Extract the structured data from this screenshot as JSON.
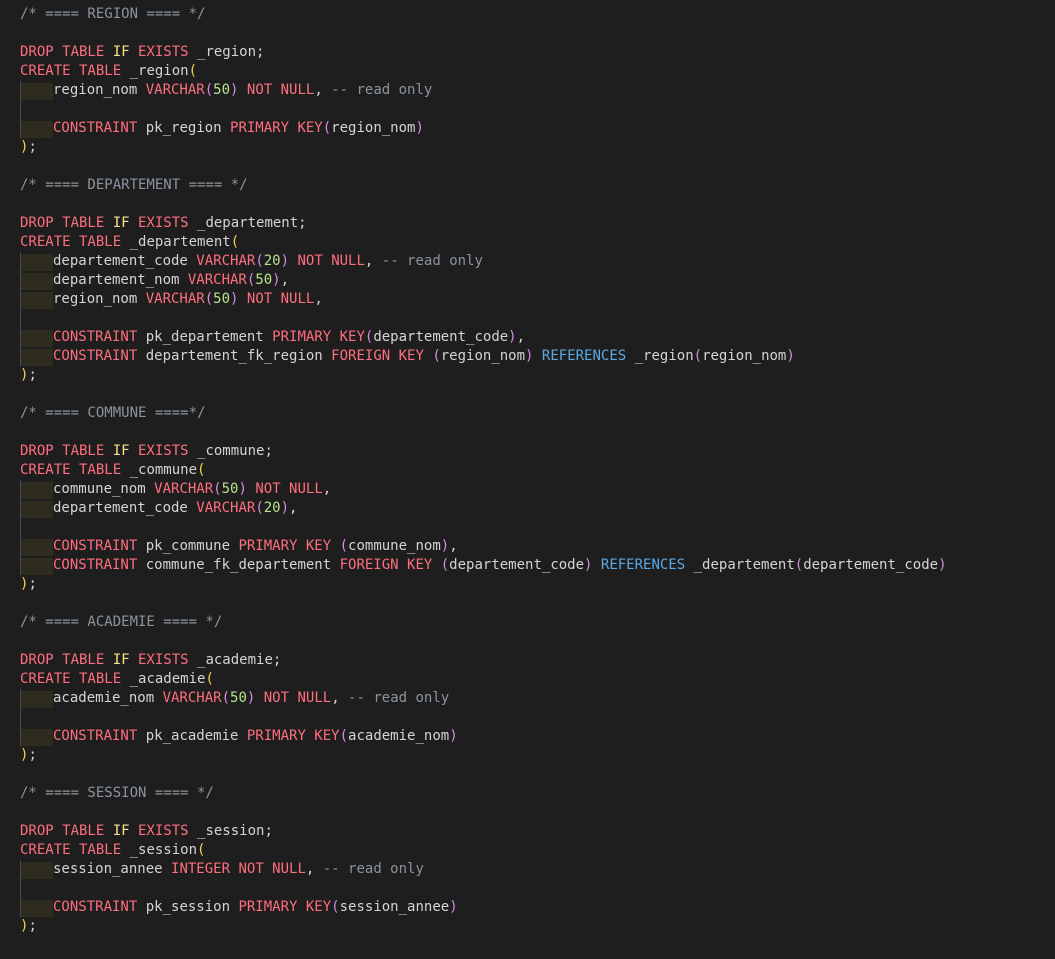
{
  "editor": {
    "lines": [
      [
        {
          "t": "/* ==== REGION ==== */",
          "c": "comment"
        }
      ],
      [],
      [
        {
          "t": "DROP TABLE ",
          "c": "kw"
        },
        {
          "t": "IF",
          "c": "kw2"
        },
        {
          "t": " EXISTS",
          "c": "kw"
        },
        {
          "t": " _region;",
          "c": "text"
        }
      ],
      [
        {
          "t": "CREATE TABLE",
          "c": "kw"
        },
        {
          "t": " _region",
          "c": "text"
        },
        {
          "t": "(",
          "c": "paren-y"
        }
      ],
      {
        "indent": true,
        "tokens": [
          {
            "t": "region_nom ",
            "c": "text"
          },
          {
            "t": "VARCHAR",
            "c": "kw"
          },
          {
            "t": "(",
            "c": "paren-p"
          },
          {
            "t": "50",
            "c": "num"
          },
          {
            "t": ")",
            "c": "paren-p"
          },
          {
            "t": " NOT NULL",
            "c": "kw"
          },
          {
            "t": ", ",
            "c": "text"
          },
          {
            "t": "-- read only",
            "c": "comment"
          }
        ]
      },
      {
        "guide": true,
        "tokens": []
      },
      {
        "indent": true,
        "tokens": [
          {
            "t": "CONSTRAINT",
            "c": "kw"
          },
          {
            "t": " pk_region ",
            "c": "text"
          },
          {
            "t": "PRIMARY KEY",
            "c": "kw"
          },
          {
            "t": "(",
            "c": "paren-p"
          },
          {
            "t": "region_nom",
            "c": "text"
          },
          {
            "t": ")",
            "c": "paren-p"
          }
        ]
      },
      [
        {
          "t": ")",
          "c": "paren-y"
        },
        {
          "t": ";",
          "c": "text"
        }
      ],
      [],
      [
        {
          "t": "/* ==== DEPARTEMENT ==== */",
          "c": "comment"
        }
      ],
      [],
      [
        {
          "t": "DROP TABLE ",
          "c": "kw"
        },
        {
          "t": "IF",
          "c": "kw2"
        },
        {
          "t": " EXISTS",
          "c": "kw"
        },
        {
          "t": " _departement;",
          "c": "text"
        }
      ],
      [
        {
          "t": "CREATE TABLE",
          "c": "kw"
        },
        {
          "t": " _departement",
          "c": "text"
        },
        {
          "t": "(",
          "c": "paren-y"
        }
      ],
      {
        "indent": true,
        "tokens": [
          {
            "t": "departement_code ",
            "c": "text"
          },
          {
            "t": "VARCHAR",
            "c": "kw"
          },
          {
            "t": "(",
            "c": "paren-p"
          },
          {
            "t": "20",
            "c": "num"
          },
          {
            "t": ")",
            "c": "paren-p"
          },
          {
            "t": " NOT NULL",
            "c": "kw"
          },
          {
            "t": ", ",
            "c": "text"
          },
          {
            "t": "-- read only",
            "c": "comment"
          }
        ]
      },
      {
        "indent": true,
        "tokens": [
          {
            "t": "departement_nom ",
            "c": "text"
          },
          {
            "t": "VARCHAR",
            "c": "kw"
          },
          {
            "t": "(",
            "c": "paren-p"
          },
          {
            "t": "50",
            "c": "num"
          },
          {
            "t": ")",
            "c": "paren-p"
          },
          {
            "t": ",",
            "c": "text"
          }
        ]
      },
      {
        "indent": true,
        "tokens": [
          {
            "t": "region_nom ",
            "c": "text"
          },
          {
            "t": "VARCHAR",
            "c": "kw"
          },
          {
            "t": "(",
            "c": "paren-p"
          },
          {
            "t": "50",
            "c": "num"
          },
          {
            "t": ")",
            "c": "paren-p"
          },
          {
            "t": " NOT NULL",
            "c": "kw"
          },
          {
            "t": ",",
            "c": "text"
          }
        ]
      },
      {
        "guide": true,
        "tokens": []
      },
      {
        "indent": true,
        "tokens": [
          {
            "t": "CONSTRAINT",
            "c": "kw"
          },
          {
            "t": " pk_departement ",
            "c": "text"
          },
          {
            "t": "PRIMARY KEY",
            "c": "kw"
          },
          {
            "t": "(",
            "c": "paren-p"
          },
          {
            "t": "departement_code",
            "c": "text"
          },
          {
            "t": ")",
            "c": "paren-p"
          },
          {
            "t": ",",
            "c": "text"
          }
        ]
      },
      {
        "indent": true,
        "tokens": [
          {
            "t": "CONSTRAINT",
            "c": "kw"
          },
          {
            "t": " departement_fk_region ",
            "c": "text"
          },
          {
            "t": "FOREIGN KEY",
            "c": "kw"
          },
          {
            "t": " (",
            "c": "paren-p"
          },
          {
            "t": "region_nom",
            "c": "text"
          },
          {
            "t": ")",
            "c": "paren-p"
          },
          {
            "t": " REFERENCES",
            "c": "ref"
          },
          {
            "t": " _region",
            "c": "text"
          },
          {
            "t": "(",
            "c": "paren-p"
          },
          {
            "t": "region_nom",
            "c": "text"
          },
          {
            "t": ")",
            "c": "paren-p"
          }
        ]
      },
      [
        {
          "t": ")",
          "c": "paren-y"
        },
        {
          "t": ";",
          "c": "text"
        }
      ],
      [],
      [
        {
          "t": "/* ==== COMMUNE ====*/",
          "c": "comment"
        }
      ],
      [],
      [
        {
          "t": "DROP TABLE ",
          "c": "kw"
        },
        {
          "t": "IF",
          "c": "kw2"
        },
        {
          "t": " EXISTS",
          "c": "kw"
        },
        {
          "t": " _commune;",
          "c": "text"
        }
      ],
      [
        {
          "t": "CREATE TABLE",
          "c": "kw"
        },
        {
          "t": " _commune",
          "c": "text"
        },
        {
          "t": "(",
          "c": "paren-y"
        }
      ],
      {
        "indent": true,
        "tokens": [
          {
            "t": "commune_nom ",
            "c": "text"
          },
          {
            "t": "VARCHAR",
            "c": "kw"
          },
          {
            "t": "(",
            "c": "paren-p"
          },
          {
            "t": "50",
            "c": "num"
          },
          {
            "t": ")",
            "c": "paren-p"
          },
          {
            "t": " NOT NULL",
            "c": "kw"
          },
          {
            "t": ",",
            "c": "text"
          }
        ]
      },
      {
        "indent": true,
        "tokens": [
          {
            "t": "departement_code ",
            "c": "text"
          },
          {
            "t": "VARCHAR",
            "c": "kw"
          },
          {
            "t": "(",
            "c": "paren-p"
          },
          {
            "t": "20",
            "c": "num"
          },
          {
            "t": ")",
            "c": "paren-p"
          },
          {
            "t": ",",
            "c": "text"
          }
        ]
      },
      {
        "guide": true,
        "tokens": []
      },
      {
        "indent": true,
        "tokens": [
          {
            "t": "CONSTRAINT",
            "c": "kw"
          },
          {
            "t": " pk_commune ",
            "c": "text"
          },
          {
            "t": "PRIMARY KEY",
            "c": "kw"
          },
          {
            "t": " (",
            "c": "paren-p"
          },
          {
            "t": "commune_nom",
            "c": "text"
          },
          {
            "t": ")",
            "c": "paren-p"
          },
          {
            "t": ",",
            "c": "text"
          }
        ]
      },
      {
        "indent": true,
        "tokens": [
          {
            "t": "CONSTRAINT",
            "c": "kw"
          },
          {
            "t": " commune_fk_departement ",
            "c": "text"
          },
          {
            "t": "FOREIGN KEY",
            "c": "kw"
          },
          {
            "t": " (",
            "c": "paren-p"
          },
          {
            "t": "departement_code",
            "c": "text"
          },
          {
            "t": ")",
            "c": "paren-p"
          },
          {
            "t": " REFERENCES",
            "c": "ref"
          },
          {
            "t": " _departement",
            "c": "text"
          },
          {
            "t": "(",
            "c": "paren-p"
          },
          {
            "t": "departement_code",
            "c": "text"
          },
          {
            "t": ")",
            "c": "paren-p"
          }
        ]
      },
      [
        {
          "t": ")",
          "c": "paren-y"
        },
        {
          "t": ";",
          "c": "text"
        }
      ],
      [],
      [
        {
          "t": "/* ==== ACADEMIE ==== */",
          "c": "comment"
        }
      ],
      [],
      [
        {
          "t": "DROP TABLE ",
          "c": "kw"
        },
        {
          "t": "IF",
          "c": "kw2"
        },
        {
          "t": " EXISTS",
          "c": "kw"
        },
        {
          "t": " _academie;",
          "c": "text"
        }
      ],
      [
        {
          "t": "CREATE TABLE",
          "c": "kw"
        },
        {
          "t": " _academie",
          "c": "text"
        },
        {
          "t": "(",
          "c": "paren-y"
        }
      ],
      {
        "indent": true,
        "tokens": [
          {
            "t": "academie_nom ",
            "c": "text"
          },
          {
            "t": "VARCHAR",
            "c": "kw"
          },
          {
            "t": "(",
            "c": "paren-p"
          },
          {
            "t": "50",
            "c": "num"
          },
          {
            "t": ")",
            "c": "paren-p"
          },
          {
            "t": " NOT NULL",
            "c": "kw"
          },
          {
            "t": ", ",
            "c": "text"
          },
          {
            "t": "-- read only",
            "c": "comment"
          }
        ]
      },
      {
        "guide": true,
        "tokens": []
      },
      {
        "indent": true,
        "tokens": [
          {
            "t": "CONSTRAINT",
            "c": "kw"
          },
          {
            "t": " pk_academie ",
            "c": "text"
          },
          {
            "t": "PRIMARY KEY",
            "c": "kw"
          },
          {
            "t": "(",
            "c": "paren-p"
          },
          {
            "t": "academie_nom",
            "c": "text"
          },
          {
            "t": ")",
            "c": "paren-p"
          }
        ]
      },
      [
        {
          "t": ")",
          "c": "paren-y"
        },
        {
          "t": ";",
          "c": "text"
        }
      ],
      [],
      [
        {
          "t": "/* ==== SESSION ==== */",
          "c": "comment"
        }
      ],
      [],
      [
        {
          "t": "DROP TABLE ",
          "c": "kw"
        },
        {
          "t": "IF",
          "c": "kw2"
        },
        {
          "t": " EXISTS",
          "c": "kw"
        },
        {
          "t": " _session;",
          "c": "text"
        }
      ],
      [
        {
          "t": "CREATE TABLE",
          "c": "kw"
        },
        {
          "t": " _session",
          "c": "text"
        },
        {
          "t": "(",
          "c": "paren-y"
        }
      ],
      {
        "indent": true,
        "tokens": [
          {
            "t": "session_annee ",
            "c": "text"
          },
          {
            "t": "INTEGER",
            "c": "kw"
          },
          {
            "t": " NOT NULL",
            "c": "kw"
          },
          {
            "t": ", ",
            "c": "text"
          },
          {
            "t": "-- read only",
            "c": "comment"
          }
        ]
      },
      {
        "guide": true,
        "tokens": []
      },
      {
        "indent": true,
        "tokens": [
          {
            "t": "CONSTRAINT",
            "c": "kw"
          },
          {
            "t": " pk_session ",
            "c": "text"
          },
          {
            "t": "PRIMARY KEY",
            "c": "kw"
          },
          {
            "t": "(",
            "c": "paren-p"
          },
          {
            "t": "session_annee",
            "c": "text"
          },
          {
            "t": ")",
            "c": "paren-p"
          }
        ]
      },
      [
        {
          "t": ")",
          "c": "paren-y"
        },
        {
          "t": ";",
          "c": "text"
        }
      ]
    ]
  }
}
